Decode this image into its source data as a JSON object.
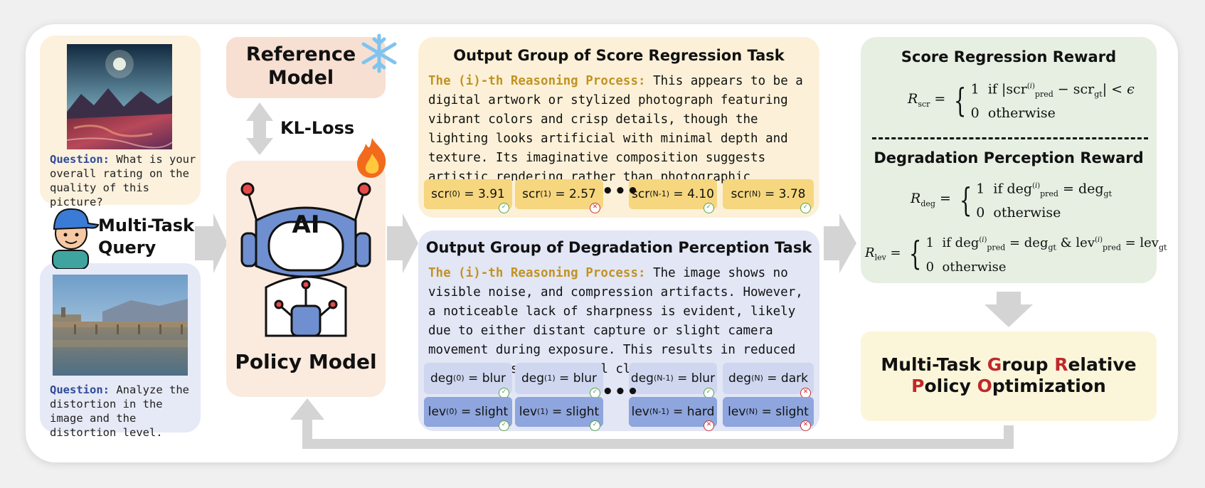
{
  "query": {
    "question1_label": "Question:",
    "question1_text": "What is your overall rating on the quality of this picture?",
    "question2_label": "Question:",
    "question2_text": "Analyze the distortion in the image and the distortion level.",
    "multi_task_line1": "Multi-Task",
    "multi_task_line2": "Query"
  },
  "models": {
    "reference_line1": "Reference",
    "reference_line2": "Model",
    "kl_loss": "KL-Loss",
    "policy": "Policy Model",
    "robot_badge": "AI"
  },
  "score_group": {
    "title": "Output Group of Score Regression Task",
    "reason_label": "The (i)-th Reasoning Process:",
    "reason_text": "This appears to be a digital artwork or stylized photograph featuring vibrant colors and crisp details, though the lighting looks artificial with minimal depth and texture. Its imaginative composition suggests artistic rendering rather than photographic capture.",
    "chips": [
      {
        "base": "scr",
        "sup": "(0)",
        "value": "= 3.91",
        "status": "ok"
      },
      {
        "base": "scr",
        "sup": "(1)",
        "value": "= 2.57",
        "status": "bad"
      },
      {
        "base": "scr",
        "sup": "(N-1)",
        "value": "= 4.10",
        "status": "ok"
      },
      {
        "base": "scr",
        "sup": "(N)",
        "value": "= 3.78",
        "status": "ok"
      }
    ],
    "ellipsis": "•••"
  },
  "degradation_group": {
    "title": "Output Group of Degradation Perception Task",
    "reason_label": "The (i)-th Reasoning Process:",
    "reason_text": "The image shows no visible noise, and compression artifacts. However, a noticeable lack of sharpness is evident, likely due to either distant capture or slight camera movement during exposure. This results in reduced edge contrast and detail clarity.",
    "deg_chips": [
      {
        "base": "deg",
        "sup": "(0)",
        "value": "= blur",
        "status": "ok"
      },
      {
        "base": "deg",
        "sup": "(1)",
        "value": "= blur",
        "status": "ok"
      },
      {
        "base": "deg",
        "sup": "(N-1)",
        "value": "= blur",
        "status": "ok"
      },
      {
        "base": "deg",
        "sup": "(N)",
        "value": "= dark",
        "status": "bad"
      }
    ],
    "lev_chips": [
      {
        "base": "lev",
        "sup": "(0)",
        "value": "= slight",
        "status": "ok"
      },
      {
        "base": "lev",
        "sup": "(1)",
        "value": "= slight",
        "status": "ok"
      },
      {
        "base": "lev",
        "sup": "(N-1)",
        "value": "= hard",
        "status": "bad"
      },
      {
        "base": "lev",
        "sup": "(N)",
        "value": "= slight",
        "status": "bad"
      }
    ],
    "ellipsis": "•••"
  },
  "rewards": {
    "score_title": "Score Regression Reward",
    "degradation_title": "Degradation Perception Reward",
    "scr_lhs": "scr",
    "deg_lhs": "deg",
    "lev_lhs": "lev",
    "if_text": "if",
    "otherwise": "otherwise",
    "one": "1",
    "zero": "0"
  },
  "grpo": {
    "line1_parts": [
      "Multi-Task ",
      "G",
      "roup ",
      "R",
      "elative"
    ],
    "line2_parts": [
      "P",
      "olicy ",
      "O",
      "ptimization"
    ]
  },
  "colors": {
    "query_top_bg": "#fbf1dd",
    "query_bottom_bg": "#e6e9f6",
    "reference_bg": "#f7dfd2",
    "policy_bg": "#fbeade",
    "score_bg": "#fcf1d8",
    "score_chip": "#f6d77f",
    "degradation_bg": "#e2e6f5",
    "deg_chip": "#cfd7f0",
    "lev_chip": "#8ea5dd",
    "reward_bg": "#e6efe2",
    "grpo_bg": "#fbf6da",
    "accent_red": "#c0282b",
    "arrow_gray": "#d4d4d4"
  }
}
